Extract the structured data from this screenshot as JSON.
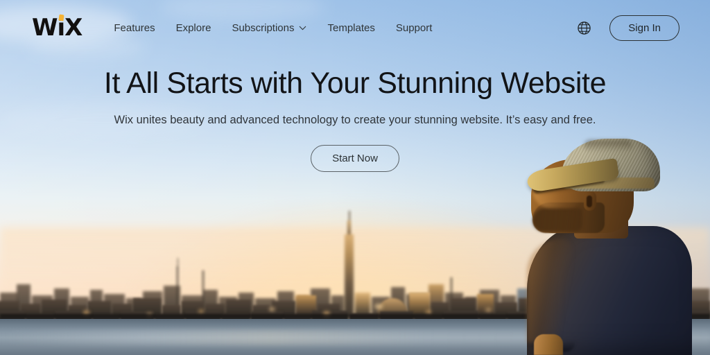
{
  "brand": {
    "logo_text": "WiX",
    "logo_dot_color": "#f5b335"
  },
  "nav": {
    "items": [
      {
        "label": "Features",
        "has_dropdown": false
      },
      {
        "label": "Explore",
        "has_dropdown": false
      },
      {
        "label": "Subscriptions",
        "has_dropdown": true
      },
      {
        "label": "Templates",
        "has_dropdown": false
      },
      {
        "label": "Support",
        "has_dropdown": false
      }
    ],
    "language_icon": "globe-icon",
    "sign_in_label": "Sign In"
  },
  "hero": {
    "headline": "It All Starts with Your Stunning Website",
    "subheadline": "Wix unites beauty and advanced technology to create your stunning website. It’s easy and free.",
    "cta_label": "Start Now"
  },
  "scene": {
    "description": "Man in straw fedora and dark navy t-shirt in profile at sunset, city skyline across the water",
    "sky_top_color": "#9fc2e8",
    "sky_horizon_color": "#f9d5b4",
    "water_color": "#8595a3",
    "text_color": "#121417"
  }
}
